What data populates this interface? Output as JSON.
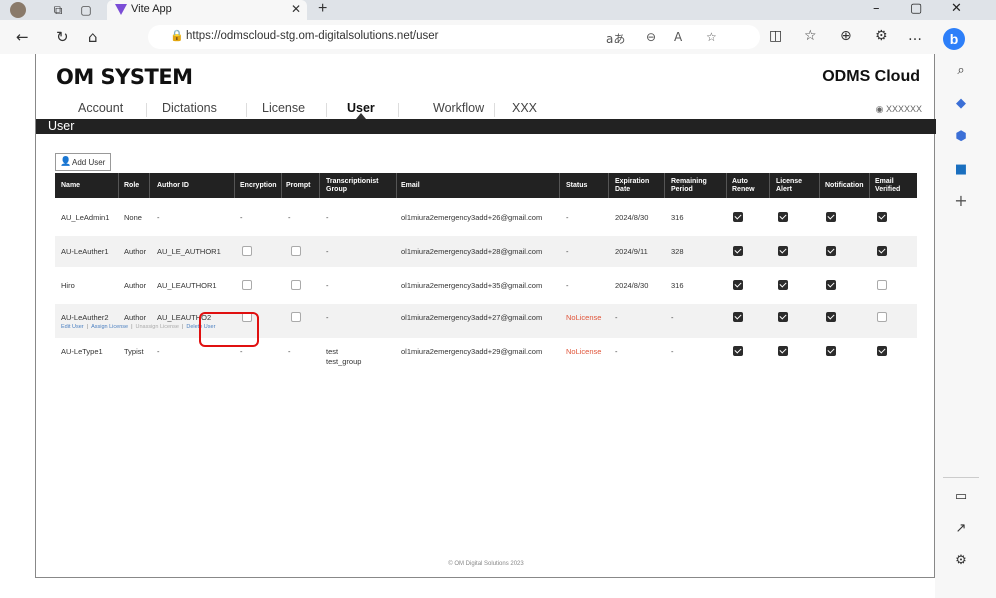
{
  "browser": {
    "tab_title": "Vite App",
    "url": "https://odmscloud-stg.om-digitalsolutions.net/user",
    "url_icons": [
      "read-aloud-text",
      "zoom-icon",
      "font-icon",
      "favorite-icon"
    ],
    "toolbar_icons": [
      "split-icon",
      "favorites-icon",
      "collections-icon",
      "extensions-icon",
      "more-icon"
    ]
  },
  "app": {
    "logo": "OM SYSTEM",
    "brand": "ODMS Cloud",
    "account_name": "XXXXXX",
    "page_title": "User",
    "menu": [
      "Account",
      "Dictations",
      "License",
      "User",
      "Workflow",
      "XXX"
    ],
    "active_menu": "User",
    "add_user_label": "Add User",
    "footer": "© OM Digital Solutions 2023"
  },
  "table": {
    "headers": {
      "name": "Name",
      "role": "Role",
      "author_id": "Author ID",
      "encryption": "Encryption",
      "prompt": "Prompt",
      "group_1": "Transcriptionist",
      "group_2": "Group",
      "email": "Email",
      "status": "Status",
      "exp_1": "Expiration",
      "exp_2": "Date",
      "rem_1": "Remaining",
      "rem_2": "Period",
      "auto_1": "Auto",
      "auto_2": "Renew",
      "alert_1": "License",
      "alert_2": "Alert",
      "notification": "Notification",
      "verified_1": "Email",
      "verified_2": "Verified"
    },
    "rows": [
      {
        "name": "AU_LeAdmin1",
        "role": "None",
        "author_id": "-",
        "encryption": "-",
        "prompt": "-",
        "group": "-",
        "group2": "",
        "email": "ol1miura2emergency3add+26@gmail.com",
        "status": "-",
        "expiration": "2024/8/30",
        "remaining": "316",
        "auto_renew": true,
        "license_alert": true,
        "notification": true,
        "email_verified": true
      },
      {
        "name": "AU-LeAuther1",
        "role": "Author",
        "author_id": "AU_LE_AUTHOR1",
        "encryption": false,
        "prompt": false,
        "group": "-",
        "group2": "",
        "email": "ol1miura2emergency3add+28@gmail.com",
        "status": "-",
        "expiration": "2024/9/11",
        "remaining": "328",
        "auto_renew": true,
        "license_alert": true,
        "notification": true,
        "email_verified": true
      },
      {
        "name": "Hiro",
        "role": "Author",
        "author_id": "AU_LEAUTHOR1",
        "encryption": false,
        "prompt": false,
        "group": "-",
        "group2": "",
        "email": "ol1miura2emergency3add+35@gmail.com",
        "status": "-",
        "expiration": "2024/8/30",
        "remaining": "316",
        "auto_renew": true,
        "license_alert": true,
        "notification": true,
        "email_verified": false
      },
      {
        "name": "AU-LeAuther2",
        "role": "Author",
        "author_id": "AU_LEAUTHO2",
        "encryption": false,
        "prompt": false,
        "group": "-",
        "group2": "",
        "email": "ol1miura2emergency3add+27@gmail.com",
        "status": "NoLicense",
        "expiration": "-",
        "remaining": "-",
        "auto_renew": true,
        "license_alert": true,
        "notification": true,
        "email_verified": false
      },
      {
        "name": "AU-LeType1",
        "role": "Typist",
        "author_id": "-",
        "encryption": "-",
        "prompt": "-",
        "group": "test",
        "group2": "test_group",
        "email": "ol1miura2emergency3add+29@gmail.com",
        "status": "NoLicense",
        "expiration": "-",
        "remaining": "-",
        "auto_renew": true,
        "license_alert": true,
        "notification": true,
        "email_verified": true
      }
    ],
    "row_actions": {
      "edit": "Edit User",
      "assign": "Assign License",
      "unassign": "Unassign License",
      "delete": "Delete User"
    }
  },
  "colors": {
    "header_bg": "#222222",
    "status_red": "#e0553a",
    "link_blue": "#4a7fc0",
    "highlight": "#e01010"
  }
}
